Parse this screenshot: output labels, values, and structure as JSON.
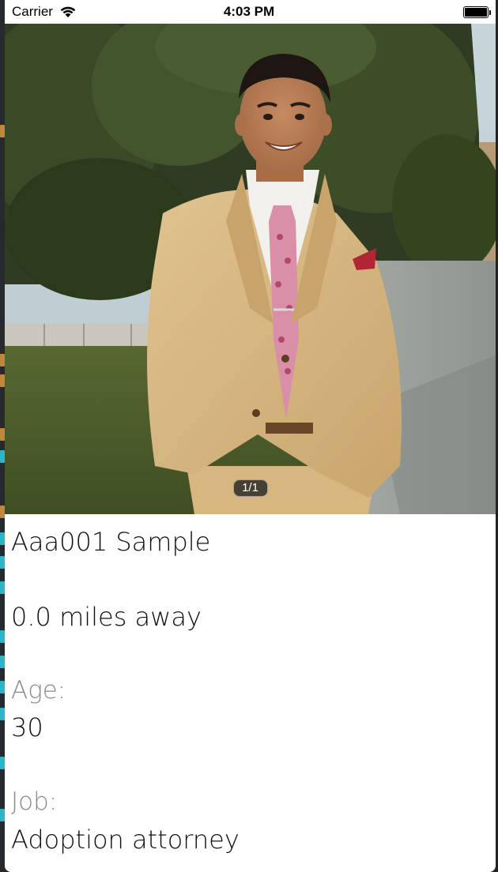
{
  "status_bar": {
    "carrier": "Carrier",
    "time": "4:03 PM",
    "wifi_icon": "wifi-icon",
    "battery_icon": "battery-icon"
  },
  "photo": {
    "description_icon": "profile-photo",
    "page_indicator": "1/1"
  },
  "profile": {
    "name": "Aaa001 Sample",
    "distance": "0.0 miles away",
    "age_label": "Age:",
    "age_value": "30",
    "job_label": "Job:",
    "job_value": "Adoption attorney"
  },
  "colors": {
    "label_gray": "#8a8a8a",
    "text_dark": "#111111",
    "background": "#ffffff"
  }
}
